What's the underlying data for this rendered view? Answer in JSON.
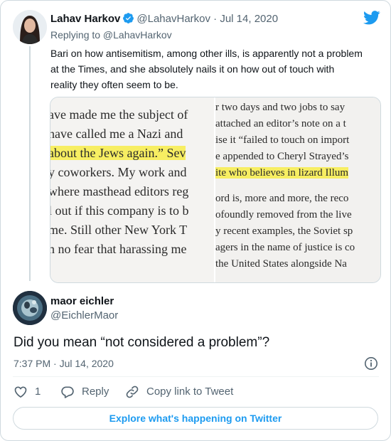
{
  "original_tweet": {
    "name": "Lahav Harkov",
    "handle": "@LahavHarkov",
    "separator": "·",
    "date": "Jul 14, 2020",
    "replying_to": "Replying to @LahavHarkov",
    "text": "Bari on how antisemitism, among other ills, is apparently not a problem at the Times, and she absolutely nails it on how out of touch with reality they often seem to be."
  },
  "media": {
    "left_lines": [
      "ave made me the subject of",
      " have called me a Nazi and",
      "about the Jews again.” Sev",
      "y coworkers. My work and",
      "where masthead editors reg",
      "l out if this company is to b",
      "me. Still other New York T",
      "n no fear that harassing me"
    ],
    "right_lines": [
      "r two days and two jobs to say",
      "attached an editor’s note on a t",
      "ise it “failed to touch on import",
      "e appended to Cheryl Strayed’s",
      "ite who believes in lizard Illum",
      "",
      "ord is, more and more, the reco",
      "ofoundly removed from the live",
      "y recent examples, the Soviet sp",
      "agers in the name of justice is co",
      "the United States alongside Na"
    ]
  },
  "reply": {
    "name": "maor eichler",
    "handle": "@EichlerMaor",
    "text": "Did you mean “not considered a problem”?",
    "time": "7:37 PM",
    "separator": "·",
    "date": "Jul 14, 2020"
  },
  "actions": {
    "like_count": "1",
    "reply_label": "Reply",
    "copy_link_label": "Copy link to Tweet"
  },
  "explore_label": "Explore what's happening on Twitter",
  "colors": {
    "twitter_blue": "#1d9bf0",
    "secondary_text": "#536471",
    "highlight": "#f7ee62"
  }
}
